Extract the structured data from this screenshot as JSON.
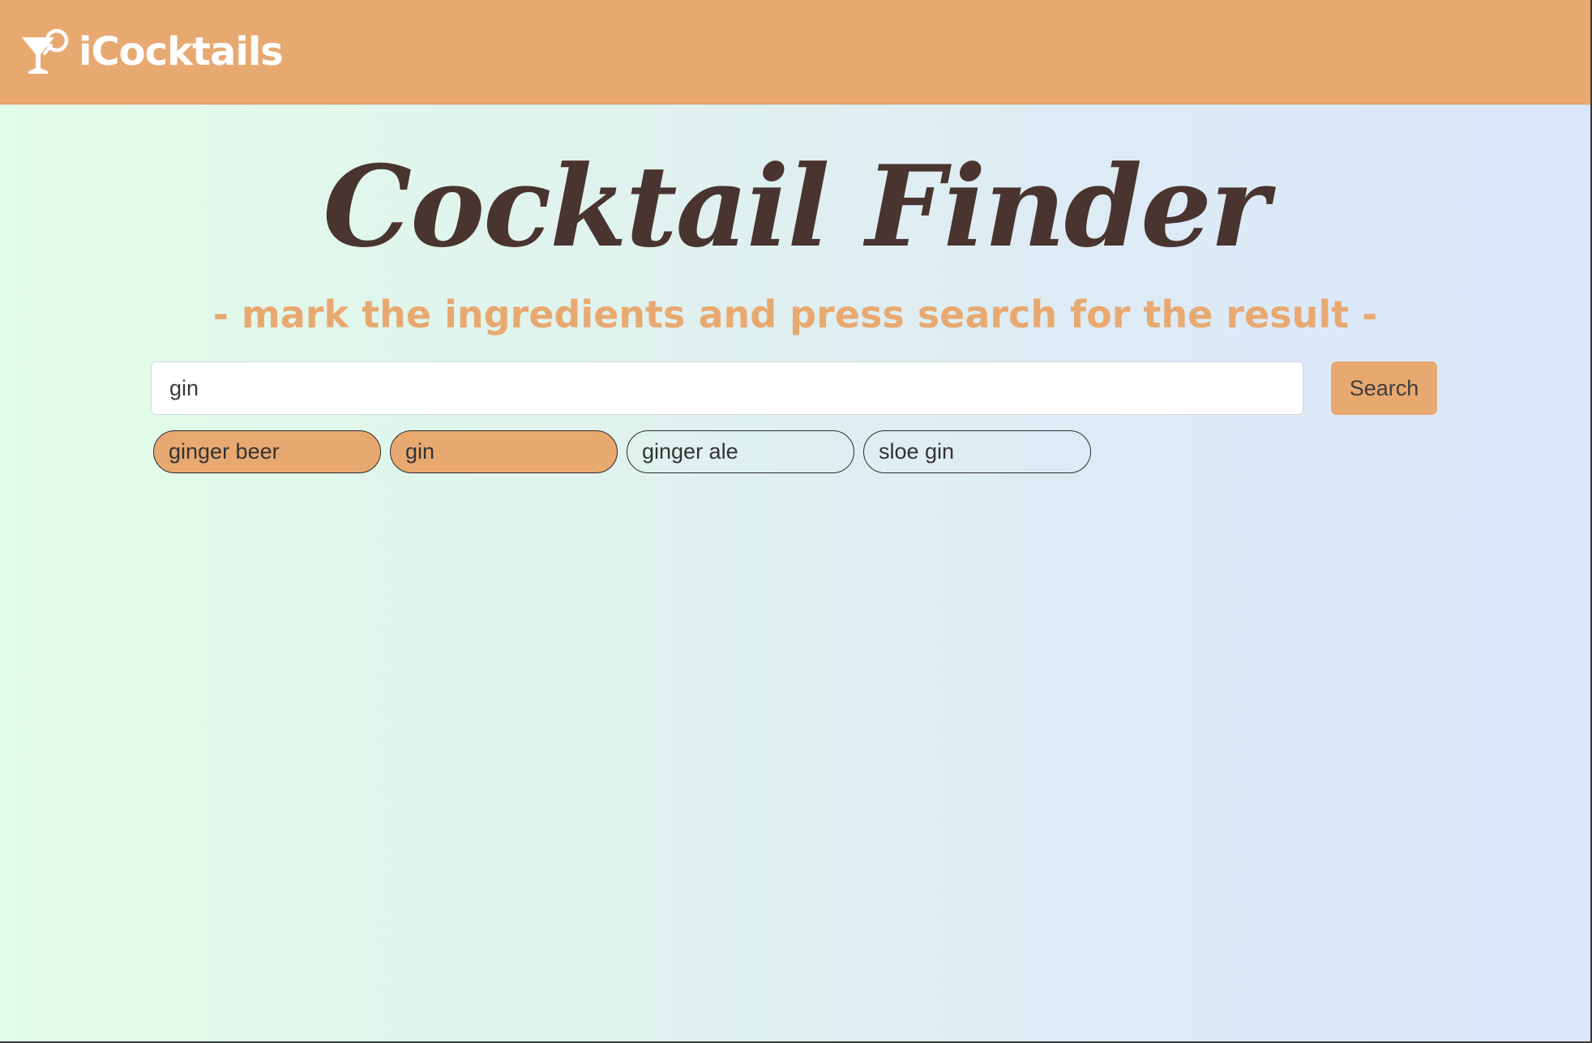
{
  "navbar": {
    "brand_icon": "cocktail-glass-icon",
    "brand_name": "iCocktails",
    "background_color": "#e8a971"
  },
  "hero": {
    "title": "Cocktail Finder",
    "subtitle": "- mark the ingredients and press search for the result -",
    "title_color": "#4a342f",
    "subtitle_color": "#e8a971"
  },
  "search": {
    "value": "gin",
    "button_label": "Search"
  },
  "suggestions": [
    {
      "label": "ginger beer",
      "selected": true
    },
    {
      "label": "gin",
      "selected": true
    },
    {
      "label": "ginger ale",
      "selected": false
    },
    {
      "label": "sloe gin",
      "selected": false
    }
  ],
  "colors": {
    "accent": "#e8a971",
    "background_left": "#e2fde8",
    "background_right": "#d9e6fc"
  }
}
